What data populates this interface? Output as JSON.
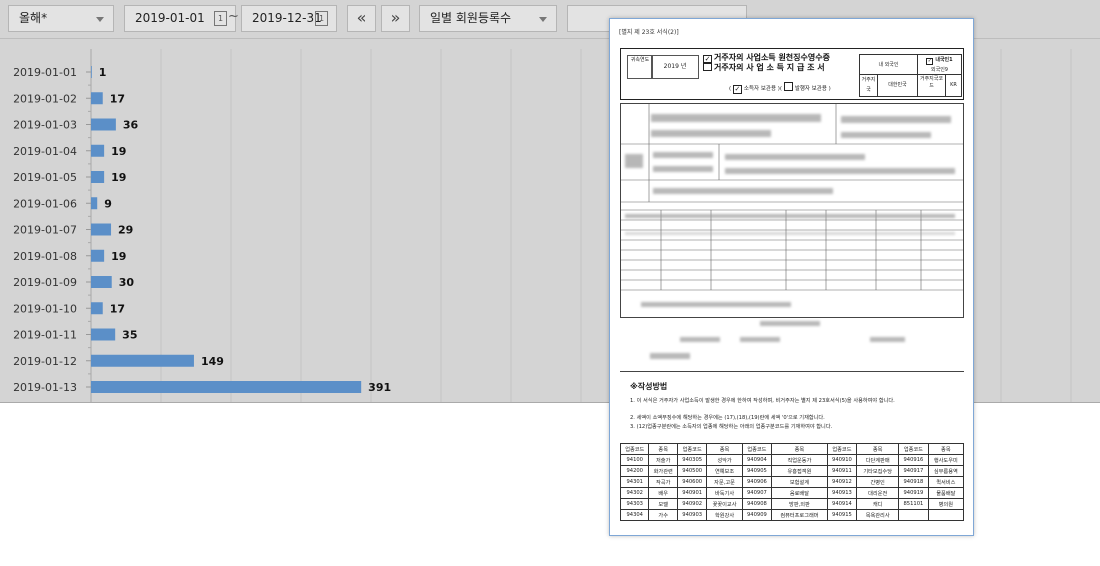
{
  "toolbar": {
    "scope_select": "올해*",
    "date_from": "2019-01-01",
    "date_to": "2019-12-31",
    "range_sep": "~",
    "cal_glyph": "1",
    "prev_label": "«",
    "next_label": "»",
    "metric_select": "일별 회원등록수",
    "search_placeholder": ""
  },
  "colors": {
    "bar": "#5b8fc8",
    "background": "#d4d4d4",
    "doc_border": "#7fa7d6"
  },
  "chart_data": {
    "type": "bar",
    "orientation": "horizontal",
    "categories": [
      "2019-01-01",
      "2019-01-02",
      "2019-01-03",
      "2019-01-04",
      "2019-01-05",
      "2019-01-06",
      "2019-01-07",
      "2019-01-08",
      "2019-01-09",
      "2019-01-10",
      "2019-01-11",
      "2019-01-12",
      "2019-01-13"
    ],
    "values": [
      1,
      17,
      36,
      19,
      19,
      9,
      29,
      19,
      30,
      17,
      35,
      149,
      391
    ],
    "title": "",
    "xlabel": "",
    "ylabel": "",
    "xlim": [
      0,
      1200
    ],
    "grid": true,
    "data_labels": true
  },
  "document": {
    "header_note": "[별지 제 23호 서식(2)]",
    "year_label": "귀속연도",
    "year_value": "2019 년",
    "title_1": "거주자의 사업소득 원천징수영수증",
    "title_2": "거주자의 사 업 소 득 지 급 조 서",
    "copy_line_1": "소득자 보관용",
    "copy_line_2": "발행자 보관용",
    "resident_label": "내 외국인",
    "resident_value": "내국인1",
    "resident_sub": "외국인9",
    "country_label": "거주지국",
    "country_value": "대한민국",
    "country_code_label": "거주지국코드",
    "country_code_value": "KR",
    "guide_title": "※작성방법",
    "guide_items": [
      "1. 이 서식은 거주자가 사업소득이 발생한 경우에 한하여 작성하며, 비거주자는 별지 제 23호서식(5)을 사용하여야 합니다.",
      "2. 세액이 소액부징수에 해당하는 경우에는 (17),(18),(19)란에 세액 '0'으로 기재합니다.",
      "3. (12)업종구분란에는 소득자의 업종에 해당하는 아래의 업종구분코드를 기재하여야 합니다."
    ],
    "jobs_header": [
      "업종코드",
      "종목",
      "업종코드",
      "종목",
      "업종코드",
      "종목",
      "업종코드",
      "종목",
      "업종코드",
      "종목"
    ],
    "jobs_rows": [
      [
        "94100",
        "저술가",
        "940305",
        "성악가",
        "940904",
        "직업운동가",
        "940910",
        "다단계판매",
        "940916",
        "행사도우미"
      ],
      [
        "94200",
        "화가관련",
        "940500",
        "연예보조",
        "940905",
        "유흥접객원",
        "940911",
        "기타모집수당",
        "940917",
        "심부름용역"
      ],
      [
        "94301",
        "작곡가",
        "940600",
        "자문,고문",
        "940906",
        "보험설계",
        "940912",
        "간병인",
        "940918",
        "퀵서비스"
      ],
      [
        "94302",
        "배우",
        "940901",
        "바둑기사",
        "940907",
        "음료배달",
        "940913",
        "대리운전",
        "940919",
        "물품배달"
      ],
      [
        "94303",
        "모델",
        "940902",
        "꽃꽂이교사",
        "940908",
        "방판,외판",
        "940914",
        "캐디",
        "851101",
        "병의원"
      ],
      [
        "94304",
        "가수",
        "940903",
        "학원강사",
        "940909",
        "컴퓨터프로그래머",
        "940915",
        "목욕관리사",
        "",
        ""
      ]
    ]
  }
}
